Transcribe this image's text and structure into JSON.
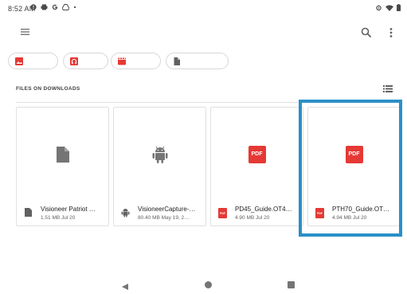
{
  "status_bar": {
    "time": "8:52 AM",
    "left_icons": [
      "alert-icon",
      "print-icon",
      "google-icon",
      "drive-icon",
      "dot-icon"
    ],
    "right_icons": [
      "sync-icon",
      "wifi-icon",
      "battery-icon"
    ]
  },
  "toolbar": {
    "menu_icon": "hamburger-menu-icon",
    "search_icon": "search-icon",
    "overflow_icon": "more-vert-icon"
  },
  "chips": [
    {
      "icon": "image-icon",
      "color": "#e53935"
    },
    {
      "icon": "audio-icon",
      "color": "#e53935"
    },
    {
      "icon": "video-icon",
      "color": "#e53935"
    },
    {
      "icon": "document-icon",
      "color": "#616161"
    }
  ],
  "section": {
    "title": "FILES ON DOWNLOADS",
    "view_toggle_icon": "list-view-icon"
  },
  "files": [
    {
      "name": "Visioneer Patriot …",
      "meta": "1.51 MB Jul 20",
      "type": "document"
    },
    {
      "name": "VisioneerCapture-…",
      "meta": "80.40 MB May 19, 2…",
      "type": "android"
    },
    {
      "name": "PD45_Guide.OT4…",
      "meta": "4.90 MB Jul 20",
      "type": "pdf"
    },
    {
      "name": "PTH70_Guide.OT…",
      "meta": "4.94 MB Jul 20",
      "type": "pdf"
    }
  ],
  "pdf_label": "PDF",
  "colors": {
    "accent_red": "#e53935",
    "highlight_blue": "#2a8fc8",
    "icon_gray": "#757575"
  },
  "nav": {
    "back_icon": "back-triangle-icon",
    "home_icon": "home-circle-icon",
    "recents_icon": "recents-square-icon"
  }
}
